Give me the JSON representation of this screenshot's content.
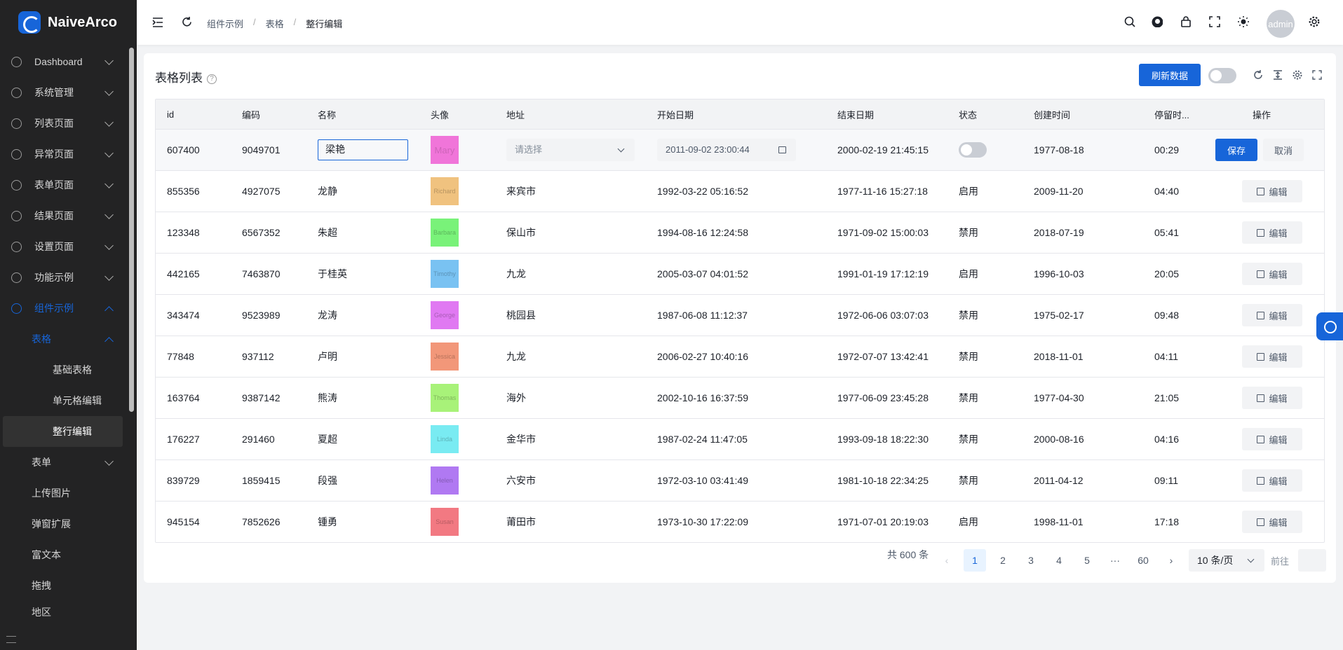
{
  "app": {
    "name": "NaiveArco"
  },
  "sidebar": {
    "items": [
      {
        "label": "Dashboard"
      },
      {
        "label": "系统管理"
      },
      {
        "label": "列表页面"
      },
      {
        "label": "异常页面"
      },
      {
        "label": "表单页面"
      },
      {
        "label": "结果页面"
      },
      {
        "label": "设置页面"
      },
      {
        "label": "功能示例"
      },
      {
        "label": "组件示例"
      }
    ],
    "sub": {
      "table": "表格",
      "basic": "基础表格",
      "cell_edit": "单元格编辑",
      "row_edit": "整行编辑",
      "form": "表单",
      "upload": "上传图片",
      "modal": "弹窗扩展",
      "richtext": "富文本",
      "drag": "拖拽",
      "region": "地区"
    }
  },
  "breadcrumb": [
    "组件示例",
    "表格",
    "整行编辑"
  ],
  "header": {
    "avatar": "admin"
  },
  "card": {
    "title": "表格列表",
    "refresh": "刷新数据"
  },
  "columns": [
    "id",
    "编码",
    "名称",
    "头像",
    "地址",
    "开始日期",
    "结束日期",
    "状态",
    "创建时间",
    "停留时...",
    "操作"
  ],
  "editing_row": {
    "id": "607400",
    "code": "9049701",
    "name": "梁艳",
    "avatar_text": "Mary",
    "avatar_color": "#f075d9",
    "address_placeholder": "请选择",
    "start": "2011-09-02 23:00:44",
    "end": "2000-02-19 21:45:15",
    "created": "1977-08-18",
    "stay": "00:29",
    "save": "保存",
    "cancel": "取消"
  },
  "rows": [
    {
      "id": "855356",
      "code": "4927075",
      "name": "龙静",
      "avatar_text": "Richard",
      "avatar_color": "#f0c27f",
      "address": "来宾市",
      "start": "1992-03-22 05:16:52",
      "end": "1977-11-16 15:27:18",
      "status": "启用",
      "created": "2009-11-20",
      "stay": "04:40",
      "action": "编辑"
    },
    {
      "id": "123348",
      "code": "6567352",
      "name": "朱超",
      "avatar_text": "Barbara",
      "avatar_color": "#79f279",
      "address": "保山市",
      "start": "1994-08-16 12:24:58",
      "end": "1971-09-02 15:00:03",
      "status": "禁用",
      "created": "2018-07-19",
      "stay": "05:41",
      "action": "编辑"
    },
    {
      "id": "442165",
      "code": "7463870",
      "name": "于桂英",
      "avatar_text": "Timothy",
      "avatar_color": "#79c2f2",
      "address": "九龙",
      "start": "2005-03-07 04:01:52",
      "end": "1991-01-19 17:12:19",
      "status": "启用",
      "created": "1996-10-03",
      "stay": "20:05",
      "action": "编辑"
    },
    {
      "id": "343474",
      "code": "9523989",
      "name": "龙涛",
      "avatar_text": "George",
      "avatar_color": "#e079f2",
      "address": "桃园县",
      "start": "1987-06-08 11:12:37",
      "end": "1972-06-06 03:07:03",
      "status": "禁用",
      "created": "1975-02-17",
      "stay": "09:48",
      "action": "编辑"
    },
    {
      "id": "77848",
      "code": "937112",
      "name": "卢明",
      "avatar_text": "Jessica",
      "avatar_color": "#f29779",
      "address": "九龙",
      "start": "2006-02-27 10:40:16",
      "end": "1972-07-07 13:42:41",
      "status": "禁用",
      "created": "2018-11-01",
      "stay": "04:11",
      "action": "编辑"
    },
    {
      "id": "163764",
      "code": "9387142",
      "name": "熊涛",
      "avatar_text": "Thomas",
      "avatar_color": "#a8f279",
      "address": "海外",
      "start": "2002-10-16 16:37:59",
      "end": "1977-06-09 23:45:28",
      "status": "禁用",
      "created": "1977-04-30",
      "stay": "21:05",
      "action": "编辑"
    },
    {
      "id": "176227",
      "code": "291460",
      "name": "夏超",
      "avatar_text": "Linda",
      "avatar_color": "#79ebf2",
      "address": "金华市",
      "start": "1987-02-24 11:47:05",
      "end": "1993-09-18 18:22:30",
      "status": "禁用",
      "created": "2000-08-16",
      "stay": "04:16",
      "action": "编辑"
    },
    {
      "id": "839729",
      "code": "1859415",
      "name": "段强",
      "avatar_text": "Helen",
      "avatar_color": "#b079f2",
      "address": "六安市",
      "start": "1972-03-10 03:41:49",
      "end": "1981-10-18 22:34:25",
      "status": "禁用",
      "created": "2011-04-12",
      "stay": "09:11",
      "action": "编辑"
    },
    {
      "id": "945154",
      "code": "7852626",
      "name": "锺勇",
      "avatar_text": "Susan",
      "avatar_color": "#f27982",
      "address": "莆田市",
      "start": "1973-10-30 17:22:09",
      "end": "1971-07-01 20:19:03",
      "status": "启用",
      "created": "1998-11-01",
      "stay": "17:18",
      "action": "编辑"
    }
  ],
  "pagination": {
    "total": "共 600 条",
    "pages": [
      "1",
      "2",
      "3",
      "4",
      "5",
      "···",
      "60"
    ],
    "size": "10 条/页",
    "goto": "前往"
  },
  "colors": {
    "accent": "#1765d9",
    "sidebar": "#232324"
  }
}
